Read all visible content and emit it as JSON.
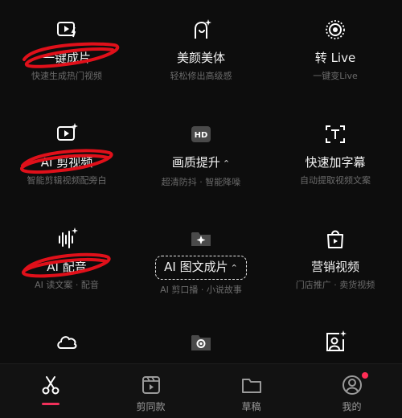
{
  "tools": [
    {
      "title": "一键成片",
      "subtitle": "快速生成热门视频",
      "icon": "play-flash-icon"
    },
    {
      "title": "美颜美体",
      "subtitle": "轻松修出高级感",
      "icon": "face-sparkle-icon"
    },
    {
      "title": "转 Live",
      "subtitle": "一键变Live",
      "icon": "live-circle-icon"
    },
    {
      "title": "AI 剪视频",
      "subtitle": "智能剪辑视频配旁白",
      "icon": "play-sparkle-icon"
    },
    {
      "title": "画质提升",
      "subtitle": "超清防抖 · 智能降噪",
      "icon": "hd-icon"
    },
    {
      "title": "快速加字幕",
      "subtitle": "自动提取视频文案",
      "icon": "text-frame-icon"
    },
    {
      "title": "AI 配音",
      "subtitle": "AI 读文案 · 配音",
      "icon": "waveform-sparkle-icon"
    },
    {
      "title": "AI 图文成片",
      "subtitle": "AI 剪口播 · 小说故事",
      "icon": "folder-sparkle-icon"
    },
    {
      "title": "营销视频",
      "subtitle": "门店推广 · 卖货视频",
      "icon": "shopping-bag-icon"
    },
    {
      "title": "",
      "subtitle": "",
      "icon": "cloud-icon"
    },
    {
      "title": "",
      "subtitle": "",
      "icon": "camera-folder-icon"
    },
    {
      "title": "",
      "subtitle": "",
      "icon": "portrait-sparkle-icon"
    }
  ],
  "dropdown_chevron": "⌃⌄",
  "tabbar": [
    {
      "label": "",
      "icon": "scissors-icon",
      "active": true
    },
    {
      "label": "剪同款",
      "icon": "film-icon"
    },
    {
      "label": "草稿",
      "icon": "folder-icon"
    },
    {
      "label": "我的",
      "icon": "profile-icon"
    }
  ],
  "colors": {
    "background": "#0d0d0d",
    "accent": "#f0305a",
    "annotation": "#e0101a",
    "badge": "#ff2d55"
  }
}
